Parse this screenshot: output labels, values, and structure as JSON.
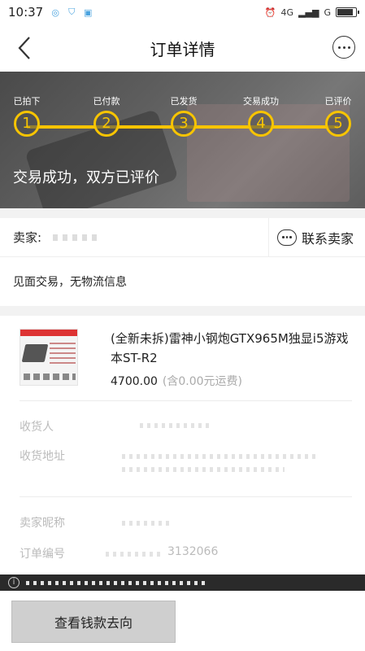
{
  "status_bar": {
    "time": "10:37",
    "network": "4G",
    "carrier": "G"
  },
  "header": {
    "title": "订单详情"
  },
  "progress": {
    "steps": [
      {
        "label": "已拍下",
        "number": "1"
      },
      {
        "label": "已付款",
        "number": "2"
      },
      {
        "label": "已发货",
        "number": "3"
      },
      {
        "label": "交易成功",
        "number": "4"
      },
      {
        "label": "已评价",
        "number": "5"
      }
    ],
    "status_text": "交易成功，双方已评价"
  },
  "seller": {
    "label": "卖家:",
    "contact_label": "联系卖家",
    "delivery_note": "见面交易，无物流信息"
  },
  "product": {
    "title": "(全新未拆)雷神小钢炮GTX965M独显i5游戏本ST-R2",
    "price": "4700.00",
    "shipping_note": "(含0.00元运费)"
  },
  "details": {
    "receiver_label": "收货人",
    "address_label": "收货地址",
    "seller_nick_label": "卖家昵称",
    "order_no_label": "订单编号",
    "order_no_value": "3132066"
  },
  "bottom": {
    "button_label": "查看钱款去向"
  },
  "colors": {
    "accent": "#f7c400",
    "banner_bg": "#5e5e5e"
  }
}
